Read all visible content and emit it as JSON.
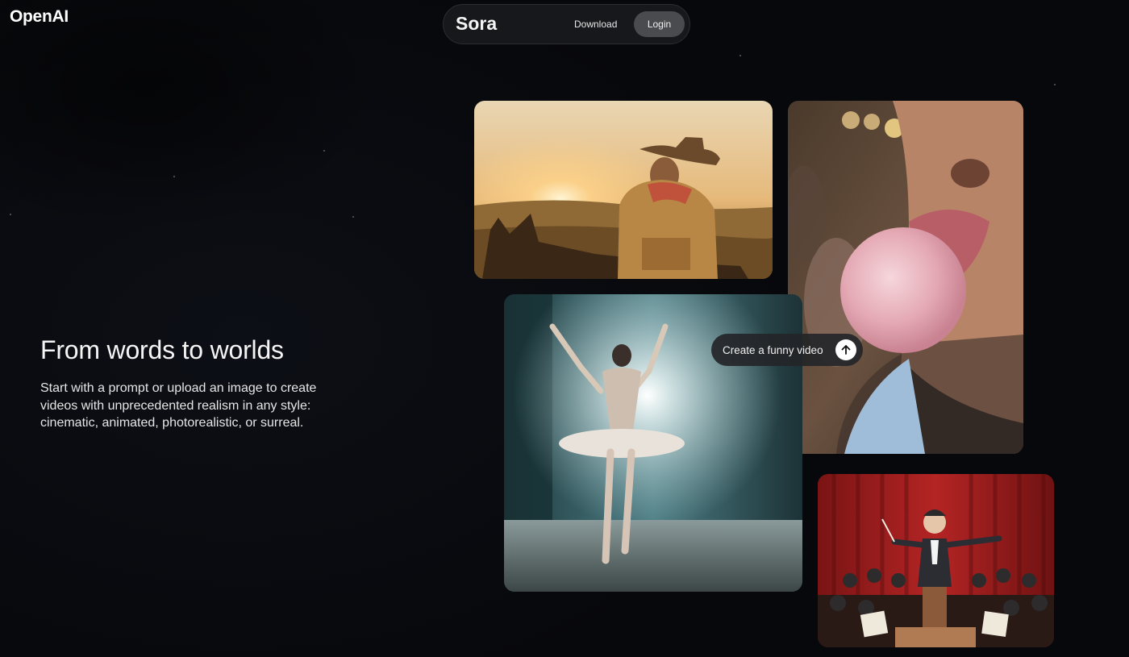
{
  "brand": {
    "logo_text": "OpenAI"
  },
  "nav": {
    "title": "Sora",
    "download_label": "Download",
    "login_label": "Login"
  },
  "hero": {
    "title": "From words to worlds",
    "description": "Start with a prompt or upload an image to create videos with unprecedented realism in any style: cinematic, animated, photorealistic, or surreal."
  },
  "prompt_chip": {
    "text": "Create a funny video",
    "icon": "arrow-up-icon"
  },
  "tiles": [
    {
      "subject": "cowboy-on-horse-at-sunset"
    },
    {
      "subject": "man-blowing-bubble-gum"
    },
    {
      "subject": "ballerina-on-stage"
    },
    {
      "subject": "clay-orchestra-conductor"
    }
  ],
  "colors": {
    "background": "#08090d",
    "nav_pill": "#17181b",
    "login_button": "#4a4b4f",
    "chip": "#242528"
  }
}
